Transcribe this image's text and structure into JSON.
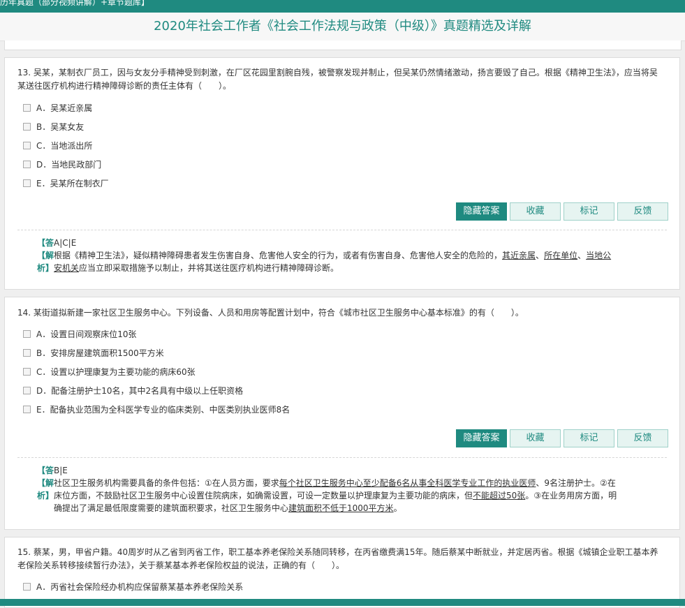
{
  "header": {
    "topbar_text": "历年真题（部分视频讲解）+章节题库】",
    "title": "2020年社会工作者《社会工作法规与政策（中级）》真题精选及详解"
  },
  "buttons": {
    "hide_answer": "隐藏答案",
    "favorite": "收藏",
    "mark": "标记",
    "feedback": "反馈"
  },
  "labels": {
    "answer_label": "【答",
    "explain_label": "【解",
    "explain_label_2": "析】"
  },
  "questions": [
    {
      "number": "13.",
      "stem": "吴某，某制衣厂员工，因与女友分手精神受到刺激，在厂区花园里割腕自残，被警察发现并制止，但吴某仍然情绪激动，扬言要毁了自己。根据《精神卫生法》，应当将吴某送往医疗机构进行精神障碍诊断的责任主体有（　　）。",
      "options": [
        {
          "key": "A．",
          "text": "吴某近亲属"
        },
        {
          "key": "B．",
          "text": "吴某女友"
        },
        {
          "key": "C．",
          "text": "当地派出所"
        },
        {
          "key": "D．",
          "text": "当地民政部门"
        },
        {
          "key": "E．",
          "text": "吴某所在制衣厂"
        }
      ],
      "answer": "A|C|E",
      "explanation": {
        "p1": "根据《精神卫生法》，疑似精神障碍患者发生伤害自身、危害他人安全的行为，或者有伤害自身、危害他人安全的危险的，",
        "u1": "其近亲属",
        "s1": "、",
        "u2": "所在单位",
        "s2": "、",
        "u3": "当地公",
        "u4": "安机关",
        "p2": "应当立即采取措施予以制止，并将其送往医疗机构进行精神障碍诊断。"
      }
    },
    {
      "number": "14.",
      "stem": "某街道拟新建一家社区卫生服务中心。下列设备、人员和用房等配置计划中，符合《城市社区卫生服务中心基本标准》的有（　　）。",
      "options": [
        {
          "key": "A．",
          "text": "设置日间观察床位10张"
        },
        {
          "key": "B．",
          "text": "安排房屋建筑面积1500平方米"
        },
        {
          "key": "C．",
          "text": "设置以护理康复为主要功能的病床60张"
        },
        {
          "key": "D．",
          "text": "配备注册护士10名，其中2名具有中级以上任职资格"
        },
        {
          "key": "E．",
          "text": "配备执业范围为全科医学专业的临床类别、中医类别执业医师8名"
        }
      ],
      "answer": "B|E",
      "explanation": {
        "p1": "社区卫生服务机构需要具备的条件包括：①在人员方面，要求",
        "u1": "每个社区卫生服务中心至少配备6名从事全科医学专业工作的执业医师",
        "p2": "、9名注册护士。②在",
        "p3": "床位方面，不鼓励社区卫生服务中心设置住院病床，如确需设置，可设一定数量以护理康复为主要功能的病床，但",
        "u2": "不能超过50张",
        "p4": "。③在业务用房方面，明",
        "p5": "确提出了满足最低限度需要的建筑面积要求，社区卫生服务中心",
        "u3": "建筑面积不低于1000平方米",
        "p6": "。"
      }
    },
    {
      "number": "15.",
      "stem": "蔡某，男，甲省户籍。40周岁时从乙省到丙省工作，职工基本养老保险关系随同转移，在丙省缴费满15年。随后蔡某中断就业，并定居丙省。根据《城镇企业职工基本养老保险关系转移接续暂行办法》，关于蔡某基本养老保险权益的说法，正确的有（　　）。",
      "options": [
        {
          "key": "A．",
          "text": "丙省社会保险经办机构应保留蔡某基本养老保险关系"
        }
      ]
    }
  ]
}
